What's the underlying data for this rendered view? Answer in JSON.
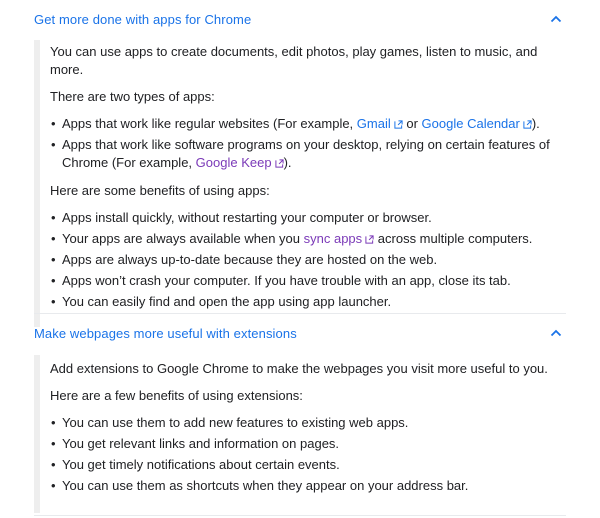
{
  "sections": [
    {
      "title": "Get more done with apps for Chrome",
      "intro": "You can use apps to create documents, edit photos, play games, listen to music, and more.",
      "types_heading": "There are two types of apps:",
      "types": [
        {
          "pre": "Apps that work like regular websites (For example, ",
          "link1": "Gmail",
          "mid": " or ",
          "link2": "Google Calendar",
          "post": ")."
        },
        {
          "pre": "Apps that work like software programs on your desktop, relying on certain features of Chrome (For example, ",
          "link1": "Google Keep",
          "post": ")."
        }
      ],
      "benefits_heading": "Here are some benefits of using apps:",
      "benefits": [
        "Apps install quickly, without restarting your computer or browser.",
        {
          "pre": "Your apps are always available when you ",
          "link": "sync apps",
          "post": " across multiple computers."
        },
        "Apps are always up-to-date because they are hosted on the web.",
        "Apps won’t crash your computer. If you have trouble with an app, close its tab.",
        "You can easily find and open the app using app launcher."
      ]
    },
    {
      "title": "Make webpages more useful with extensions",
      "intro": "Add extensions to Google Chrome to make the webpages you visit more useful to you.",
      "benefits_heading": "Here are a few benefits of using extensions:",
      "benefits": [
        "You can use them to add new features to existing web apps.",
        "You get relevant links and information on pages.",
        "You get timely notifications about certain events.",
        "You can use them as shortcuts when they appear on your address bar."
      ]
    }
  ],
  "bullet_char": "•",
  "colors": {
    "link": "#1a73e8",
    "visited_link": "#7b3ab8",
    "body_text": "#202124",
    "rail": "#eeeeee"
  },
  "icons": {
    "expander": "chevron-up-icon",
    "external": "external-link-icon"
  }
}
